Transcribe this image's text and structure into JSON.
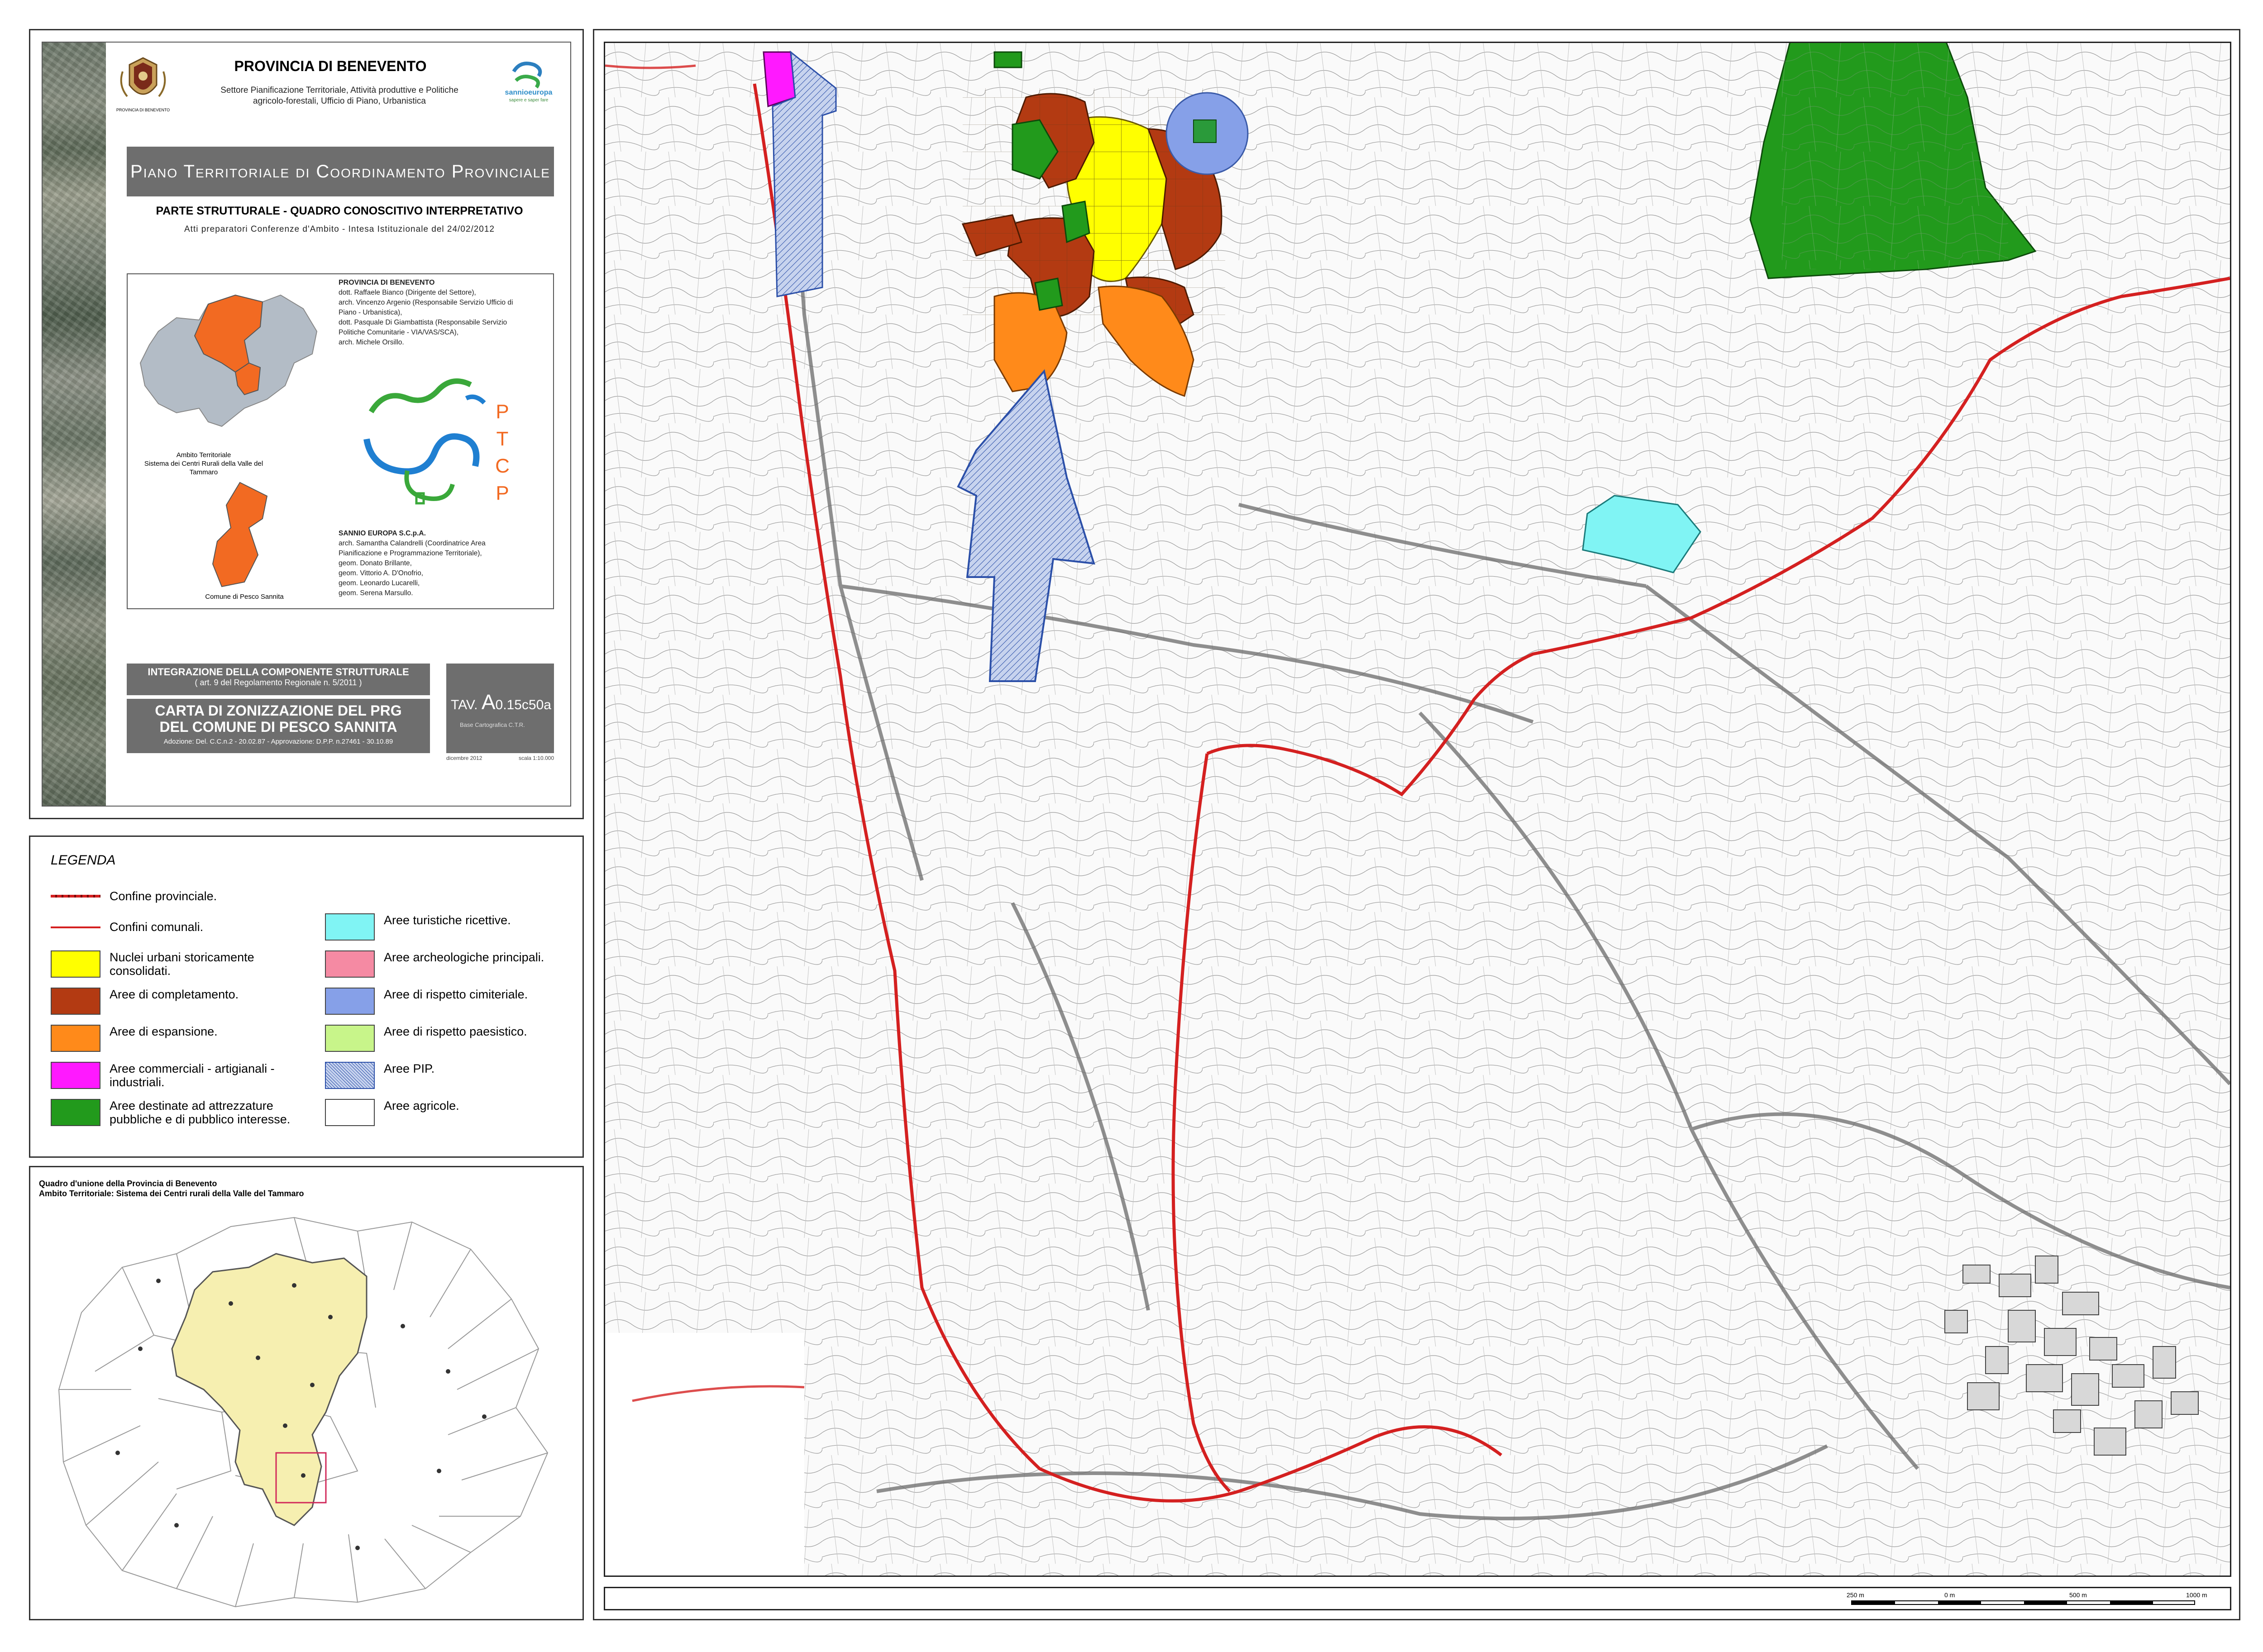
{
  "title_panel": {
    "province": "PROVINCIA DI BENEVENTO",
    "logo_caption": "PROVINCIA DI BENEVENTO",
    "sector_line1": "Settore Pianificazione Territoriale, Attività produttive e Politiche",
    "sector_line2": "agricolo-forestali, Ufficio di Piano, Urbanistica",
    "sannio_logo_text": "sannioeuropa",
    "sannio_tagline": "sapere e saper fare",
    "ptcp_title": "Piano Territoriale di Coordinamento Provinciale",
    "parte": "PARTE STRUTTURALE - QUADRO CONOSCITIVO INTERPRETATIVO",
    "atti": "Atti preparatori Conferenze d'Ambito - Intesa Istituzionale del 24/02/2012",
    "credits_heading": "PROVINCIA DI BENEVENTO",
    "credits": [
      "dott. Raffaele Bianco (Dirigente del Settore),",
      "arch. Vincenzo Argenio (Responsabile Servizio Ufficio di",
      "Piano - Urbanistica),",
      "dott. Pasquale Di Giambattista (Responsabile Servizio",
      "Politiche Comunitarie - VIA/VAS/SCA),",
      "arch. Michele Orsillo."
    ],
    "credits2_heading": "SANNIO EUROPA S.C.p.A.",
    "credits2": [
      "arch. Samantha Calandrelli (Coordinatrice Area",
      "Pianificazione e Programmazione Territoriale),",
      "geom. Donato Brillante,",
      "geom. Vittorio A. D'Onofrio,",
      "geom. Leonardo Lucarelli,",
      "geom. Serena Marsullo."
    ],
    "ambito_caption_1": "Ambito Territoriale",
    "ambito_caption_2": "Sistema dei Centri Rurali della Valle del Tammaro",
    "comune_caption": "Comune di Pesco Sannita",
    "ptcp_letters": [
      "P",
      "T",
      "C",
      "P"
    ],
    "integr_title": "INTEGRAZIONE DELLA COMPONENTE STRUTTURALE",
    "integr_sub": "( art. 9 del Regolamento Regionale n. 5/2011 )",
    "carta_line1": "CARTA DI ZONIZZAZIONE DEL PRG",
    "carta_line2": "DEL COMUNE DI PESCO SANNITA",
    "carta_sub": "Adozione: Del. C.C.n.2 - 20.02.87 - Approvazione: D.P.P. n.27461 - 30.10.89",
    "tav_prefix": "TAV.",
    "tav_letter": "A",
    "tav_code": "0.15c50a",
    "tav_base": "Base Cartografica C.T.R.",
    "tav_date": "dicembre 2012",
    "tav_scale": "scala 1:10.000"
  },
  "legend": {
    "title": "LEGENDA",
    "lines": [
      {
        "label": "Confine provinciale."
      },
      {
        "label": "Confini comunali."
      }
    ],
    "items_left": [
      {
        "label": "Nuclei urbani storicamente consolidati.",
        "color": "#ffff00"
      },
      {
        "label": "Aree di completamento.",
        "color": "#b33a12"
      },
      {
        "label": "Aree di espansione.",
        "color": "#ff8a1a"
      },
      {
        "label": "Aree commerciali - artigianali - industriali.",
        "color": "#ff19ff"
      },
      {
        "label": "Aree destinate ad attrezzature pubbliche e di pubblico interesse.",
        "color": "#229a1c"
      }
    ],
    "items_right": [
      {
        "label": "Aree turistiche ricettive.",
        "color": "#80f4f4"
      },
      {
        "label": "Aree archeologiche principali.",
        "color": "#f58aa3"
      },
      {
        "label": "Aree di rispetto cimiteriale.",
        "color": "#86a0e8"
      },
      {
        "label": "Aree di rispetto paesistico.",
        "color": "#c8f58a"
      },
      {
        "label": "Aree PIP.",
        "color": "#c7d3ee"
      },
      {
        "label": "Aree agricole.",
        "color": "#ffffff"
      }
    ]
  },
  "quadro": {
    "title_1": "Quadro d'unione della Provincia di Benevento",
    "title_2": "Ambito Territoriale: Sistema dei Centri rurali della Valle del Tammaro"
  },
  "map": {
    "scale_labels": [
      "250 m",
      "0 m",
      "500 m",
      "1000 m"
    ]
  }
}
